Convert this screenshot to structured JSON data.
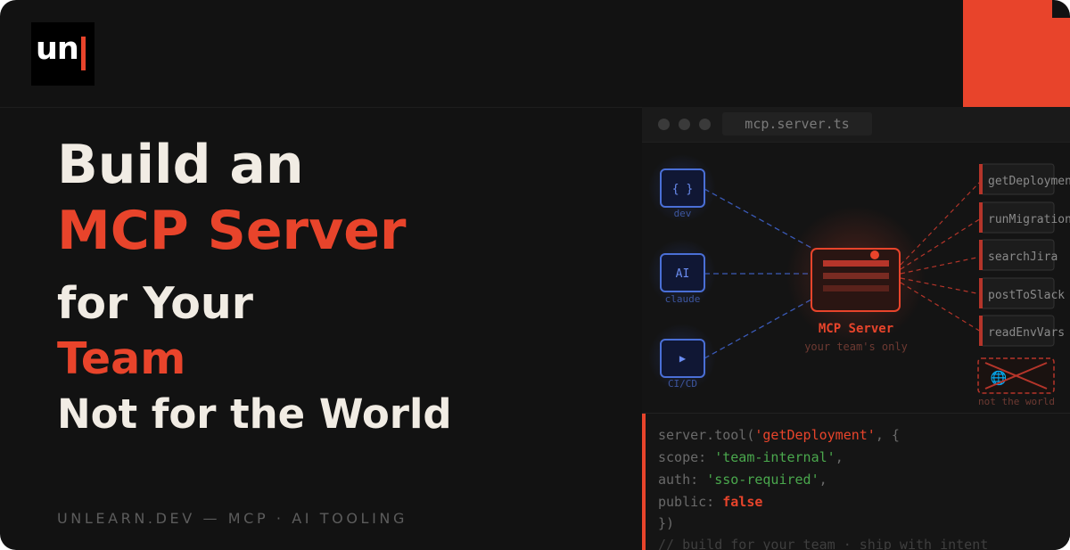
{
  "brand": {
    "logo_text": "un"
  },
  "headline": {
    "line1": "Build an",
    "line2": "MCP Server",
    "line3": "for Your",
    "line4": "Team",
    "line5": "Not for the World"
  },
  "footer_text": "UNLEARN.DEV — MCP · AI TOOLING",
  "editor": {
    "tab_title": "mcp.server.ts",
    "clients": [
      {
        "icon": "{ }",
        "label": "dev"
      },
      {
        "icon": "AI",
        "label": "claude"
      },
      {
        "icon": "▶",
        "label": "CI/CD"
      }
    ],
    "server": {
      "title": "MCP Server",
      "subtitle": "your team's only"
    },
    "tools": [
      "getDeployment",
      "runMigration",
      "searchJira",
      "postToSlack",
      "readEnvVars"
    ],
    "blocked_label": "not the world",
    "code": {
      "l1_a": "server.tool(",
      "l1_b": "'getDeployment'",
      "l1_c": ", {",
      "l2_a": "scope: ",
      "l2_b": "'team-internal'",
      "l2_c": ",",
      "l3_a": "auth: ",
      "l3_b": "'sso-required'",
      "l3_c": ",",
      "l4_a": "public: ",
      "l4_b": "false",
      "l5": "})",
      "l6": "// build for your team · ship with intent"
    }
  },
  "colors": {
    "accent": "#e8442b",
    "background": "#121212",
    "text": "#f1ece4",
    "client_blue": "#4a6fd6",
    "code_green": "#4aa84d"
  }
}
